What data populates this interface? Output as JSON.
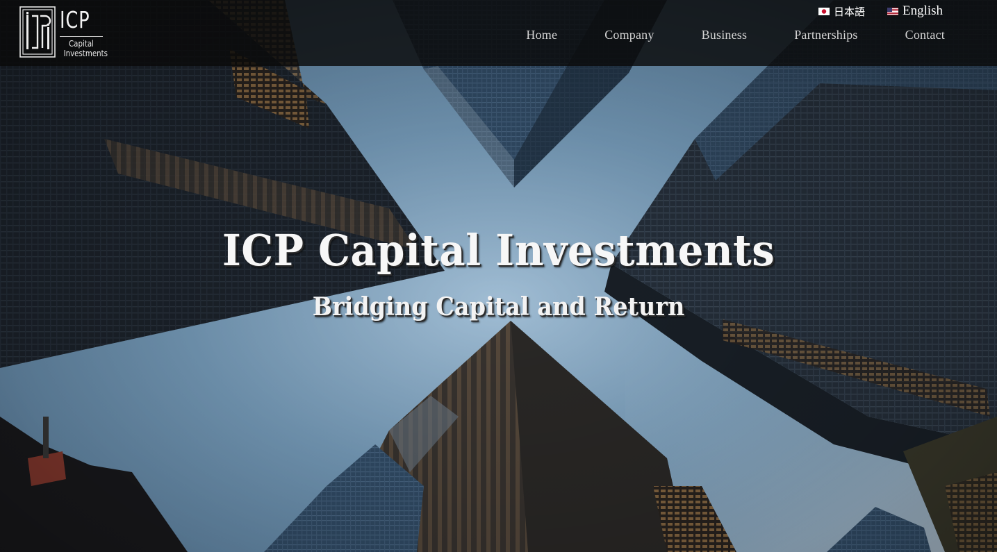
{
  "header": {
    "logo": {
      "title": "ICP",
      "subtitle_line1": "Capital",
      "subtitle_line2": "Investments",
      "icon": "icp-monogram-logo"
    },
    "languages": [
      {
        "label": "日本語",
        "flag": "japan-flag-icon"
      },
      {
        "label": "English",
        "flag": "us-flag-icon"
      }
    ],
    "nav": [
      {
        "label": "Home"
      },
      {
        "label": "Company"
      },
      {
        "label": "Business"
      },
      {
        "label": "Partnerships"
      },
      {
        "label": "Contact"
      }
    ]
  },
  "hero": {
    "title": "ICP Capital Investments",
    "subtitle": "Bridging Capital and Return",
    "background": "skyscrapers-looking-up-photo"
  },
  "colors": {
    "header_bg": "#0a0a0a",
    "nav_text": "#d4d4d4",
    "hero_text": "#f7f7f7",
    "sky": "#7fa7c8"
  }
}
